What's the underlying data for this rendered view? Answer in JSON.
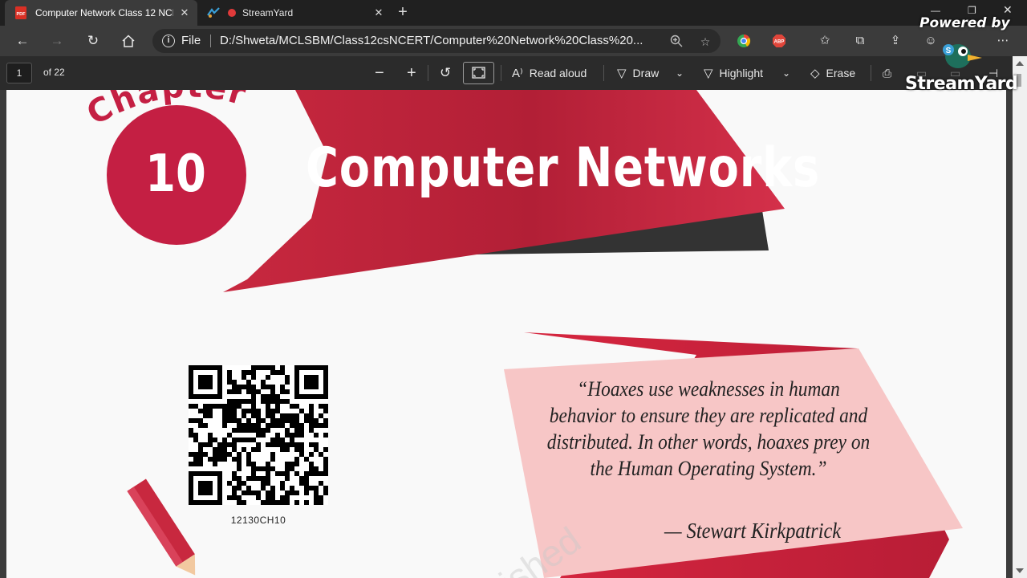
{
  "browser": {
    "tabs": [
      {
        "title": "Computer Network Class 12 NCERT",
        "favicon": "pdf-icon",
        "active": true
      },
      {
        "title": "StreamYard",
        "favicon": "recording-dot-icon",
        "active": false
      }
    ],
    "address": {
      "scheme_label": "File",
      "url": "D:/Shweta/MCLSBM/Class12csNCERT/Computer%20Network%20Class%20..."
    },
    "extensions": [
      "chrome-extension-icon",
      "adblock-plus-icon"
    ],
    "colors": {
      "tabstrip": "#202020",
      "toolbar": "#3b3b3b",
      "accent_abp": "#e0453a"
    }
  },
  "pdf_toolbar": {
    "page_number": "1",
    "page_total": "of 22",
    "read_aloud": "Read aloud",
    "draw": "Draw",
    "highlight": "Highlight",
    "erase": "Erase"
  },
  "document": {
    "chapter_word": "Chapter",
    "chapter_number": "10",
    "chapter_title": "Computer Networks",
    "qr_code_label": "12130CH10",
    "quote_lines": [
      "“Hoaxes use weaknesses in human",
      "behavior to ensure they are replicated and",
      "distributed.  In other words, hoaxes prey on",
      "the Human Operating System.”"
    ],
    "quote_author": "— Stewart Kirkpatrick",
    "watermark": "ished",
    "colors": {
      "banner_red": "#c8283f",
      "banner_dark": "#333333",
      "quote_bg": "#f7c6c6",
      "circle": "#c41f43"
    }
  },
  "overlay": {
    "powered_by": "Powered by",
    "brand": "StreamYard"
  }
}
